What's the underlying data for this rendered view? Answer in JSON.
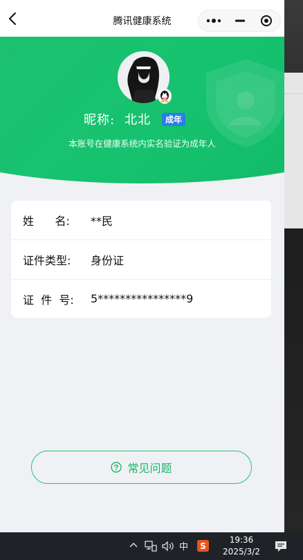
{
  "window": {
    "title": "腾讯健康系统"
  },
  "profile": {
    "nickname_label": "昵称:",
    "nickname_value": "北北",
    "age_badge": "成年",
    "verify_text": "本账号在健康系统内实名验证为成年人"
  },
  "info": {
    "rows": [
      {
        "label": "姓      名:",
        "value": "**民"
      },
      {
        "label": "证件类型:",
        "value": "身份证"
      },
      {
        "label": "证  件  号:",
        "value": "5****************9"
      }
    ]
  },
  "faq": {
    "label": "常见问题"
  },
  "taskbar": {
    "ime": "中",
    "time": "19:36",
    "date": "2025/3/2"
  },
  "colors": {
    "brand_green": "#16c26f",
    "badge_blue": "#2b7de9"
  }
}
